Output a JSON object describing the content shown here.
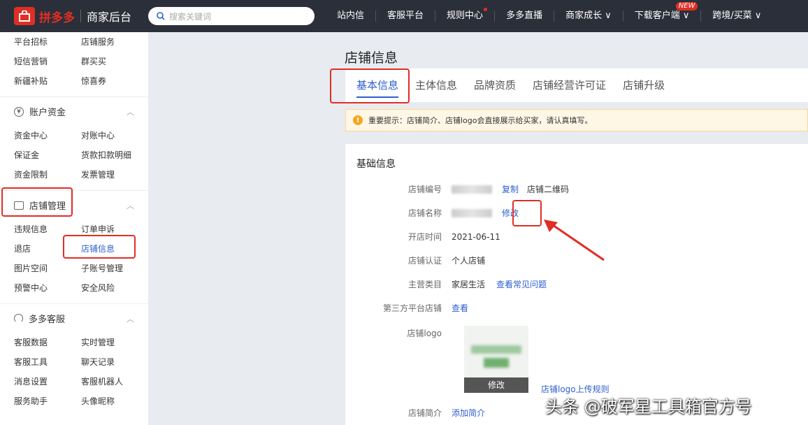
{
  "header": {
    "logo_text": "拼多多",
    "subtitle": "商家后台",
    "search_placeholder": "搜索关键词",
    "nav": [
      {
        "label": "站内信"
      },
      {
        "label": "客服平台"
      },
      {
        "label": "规则中心"
      },
      {
        "label": "多多直播"
      },
      {
        "label": "商家成长 ∨"
      },
      {
        "label": "下载客户端 ∨",
        "badge": "NEW"
      },
      {
        "label": "跨境/买菜 ∨"
      }
    ]
  },
  "sidebar": {
    "top_items": [
      "平台招标",
      "店铺服务",
      "短信营销",
      "群买买",
      "新疆补贴",
      "惊喜券"
    ],
    "sections": [
      {
        "title": "账户资金",
        "items": [
          "资金中心",
          "对账中心",
          "保证金",
          "货款扣款明细",
          "资金限制",
          "发票管理"
        ]
      },
      {
        "title": "店铺管理",
        "items": [
          "违规信息",
          "订单申诉",
          "退店",
          "店铺信息",
          "图片空间",
          "子账号管理",
          "预警中心",
          "安全风险"
        ]
      },
      {
        "title": "多多客服",
        "items": [
          "客服数据",
          "实时管理",
          "客服工具",
          "聊天记录",
          "消息设置",
          "客服机器人",
          "服务助手",
          "头像昵称"
        ]
      }
    ]
  },
  "page": {
    "title": "店铺信息",
    "tabs": [
      "基本信息",
      "主体信息",
      "品牌资质",
      "店铺经营许可证",
      "店铺升级"
    ],
    "notice": "重要提示：店铺简介、店铺logo会直接展示给买家，请认真填写。",
    "card_title": "基础信息",
    "fields": {
      "shop_id_label": "店铺编号",
      "copy": "复制",
      "qrcode": "店铺二维码",
      "shop_name_label": "店铺名称",
      "edit": "修改",
      "open_label": "开店时间",
      "open_value": "2021-06-11",
      "cert_label": "店铺认证",
      "cert_value": "个人店铺",
      "cat_label": "主营类目",
      "cat_value": "家居生活",
      "faq": "查看常见问题",
      "third_label": "第三方平台店铺",
      "third_link": "查看",
      "logo_label": "店铺logo",
      "logo_edit": "修改",
      "logo_rule": "店铺logo上传规则",
      "intro_label": "店铺简介",
      "intro_link": "添加简介"
    }
  },
  "watermark": "头条 @破军星工具箱官方号",
  "colors": {
    "accent": "#2f5fcf",
    "brand": "#e02e24",
    "highlight": "#e02e24"
  }
}
